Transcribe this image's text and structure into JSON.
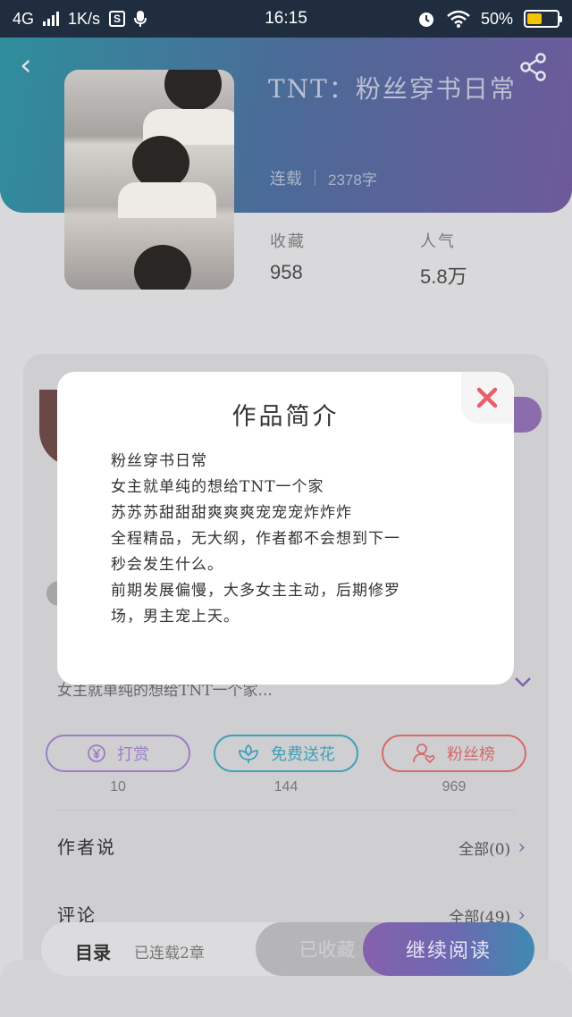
{
  "status_bar": {
    "network": "4G",
    "speed": "1K/s",
    "s_badge": "S",
    "time": "16:15",
    "battery_percent": "50%",
    "battery_level": 0.5
  },
  "book": {
    "title": "TNT：粉丝穿书日常",
    "status": "连载",
    "word_count": "2378字"
  },
  "stats": {
    "favorites_label": "收藏",
    "favorites_value": "958",
    "popularity_label": "人气",
    "popularity_value": "5.8万"
  },
  "intro_preview": "女主就单纯的想给TNT一个家...",
  "actions": [
    {
      "label": "打赏",
      "count": "10",
      "color": "#9c7dc6",
      "icon": "yen-coin-icon"
    },
    {
      "label": "免费送花",
      "count": "144",
      "color": "#3fa0b6",
      "icon": "flower-icon"
    },
    {
      "label": "粉丝榜",
      "count": "969",
      "color": "#d46a6a",
      "icon": "fan-heart-icon"
    }
  ],
  "author_says": {
    "label": "作者说",
    "link": "全部(0)"
  },
  "comments": {
    "label": "评论",
    "link": "全部(49)"
  },
  "bottom_bar": {
    "toc_label": "目录",
    "chapters": "已连载2章",
    "favorited_label": "已收藏",
    "continue_label": "继续阅读"
  },
  "modal": {
    "title": "作品简介",
    "lines": [
      "粉丝穿书日常",
      "女主就单纯的想给TNT一个家",
      "苏苏苏甜甜甜爽爽爽宠宠宠炸炸炸",
      "全程精品，无大纲，作者都不会想到下一",
      "秒会发生什么。",
      "前期发展偏慢，大多女主主动，后期修罗",
      "场，男主宠上天。"
    ]
  },
  "colors": {
    "header_gradient_start": "#2f8e9c",
    "header_gradient_end": "#6e5a9a",
    "accent_purple": "#7b63b0",
    "close_red": "#e8606a"
  }
}
